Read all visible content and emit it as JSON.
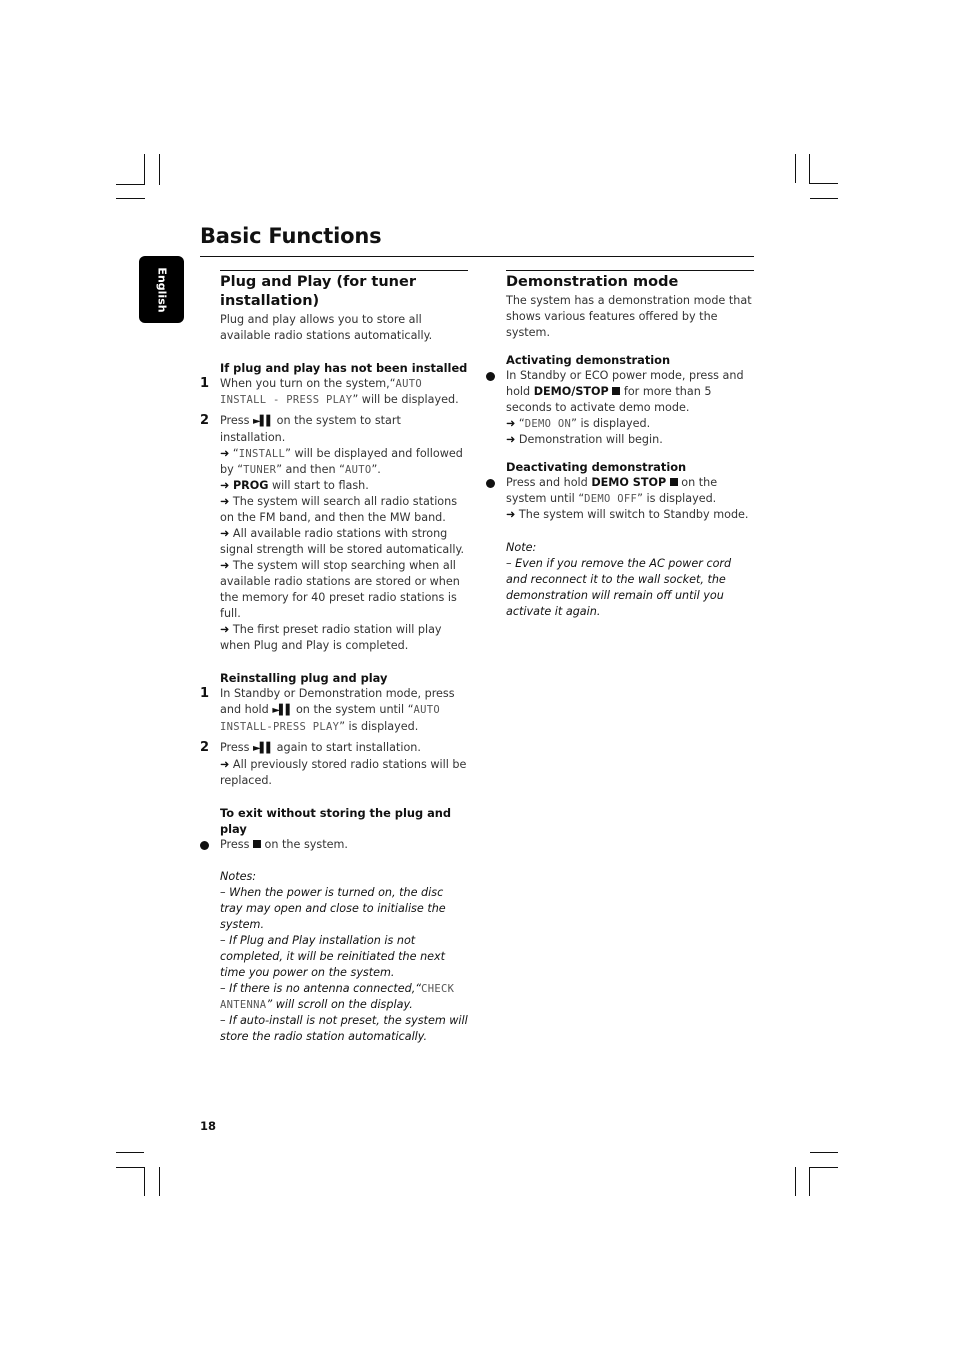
{
  "page": {
    "title": "Basic Functions",
    "language_tab": "English",
    "page_number": "18"
  },
  "left": {
    "section_title": "Plug and Play (for tuner installation)",
    "intro": "Plug and play allows you to store all available radio stations automatically.",
    "not_installed": {
      "heading": "If plug and play has not been installed",
      "step1": {
        "num": "1",
        "pre": "When you turn on the system,“",
        "lcd": "AUTO INSTALL - PRESS PLAY",
        "post": "” will be displayed."
      },
      "step2": {
        "num": "2",
        "pre": "Press ",
        "play_icon": "►▌▌",
        "post": " on the system to start installation.",
        "r1_pre": " “",
        "r1_lcd1": "INSTALL",
        "r1_mid": "” will be displayed and followed by “",
        "r1_lcd2": "TUNER",
        "r1_mid2": "” and then “",
        "r1_lcd3": "AUTO",
        "r1_post": "”.",
        "r2_bold": "PROG",
        "r2_post": " will start to flash.",
        "r3": " The system will search all radio stations on the FM band, and then the MW band.",
        "r4": " All available radio stations with strong signal strength will be stored automatically.",
        "r5": " The system will stop searching when all available radio stations are stored or when the memory for 40 preset radio stations is full.",
        "r6": " The first preset radio station will play when Plug and Play is completed."
      }
    },
    "reinstall": {
      "heading": "Reinstalling plug and play",
      "step1": {
        "num": "1",
        "pre": "In Standby or Demonstration mode, press and hold ",
        "post": "  on the system until “",
        "lcd": "AUTO INSTALL-PRESS PLAY",
        "end": "” is displayed."
      },
      "step2": {
        "num": "2",
        "pre": "Press ",
        "post": " again to start installation.",
        "r1": " All previously stored radio stations will be replaced."
      }
    },
    "exit": {
      "heading": "To exit without storing the plug and play",
      "pre": "Press ",
      "post": " on the system."
    },
    "notes": {
      "heading": "Notes:",
      "n1": "–  When the power is turned on, the disc tray may open and close to initialise the system.",
      "n2": "–  If Plug and Play installation is not completed, it will be reinitiated the next time you power on the system.",
      "n3_pre": "–  If there is no antenna connected,“",
      "n3_lcd": "CHECK ANTENNA",
      "n3_post": "” will scroll on the display.",
      "n4": "–  If auto-install is not preset, the system will store the radio station automatically."
    }
  },
  "right": {
    "section_title": "Demonstration mode",
    "intro": "The system has a demonstration mode that shows various features offered by the system.",
    "activate": {
      "heading": "Activating demonstration",
      "pre": "In Standby or ECO power mode, press and hold ",
      "bold": "DEMO/STOP",
      "post": " for more than 5 seconds to activate demo mode.",
      "r1_pre": " “",
      "r1_lcd": "DEMO ON",
      "r1_post": "” is displayed.",
      "r2": " Demonstration will begin."
    },
    "deactivate": {
      "heading": "Deactivating demonstration",
      "pre": "Press and hold ",
      "bold": "DEMO STOP",
      "post": " on the system until “",
      "lcd": "DEMO OFF",
      "end": "” is displayed.",
      "r1": " The system will switch to Standby mode."
    },
    "note": {
      "heading": "Note:",
      "n1": "–  Even if you remove the AC power cord and reconnect it to the wall socket, the demonstration will remain off until you activate it again."
    }
  },
  "icons": {
    "arrow": "➜",
    "play_pause": "►▌▌"
  }
}
